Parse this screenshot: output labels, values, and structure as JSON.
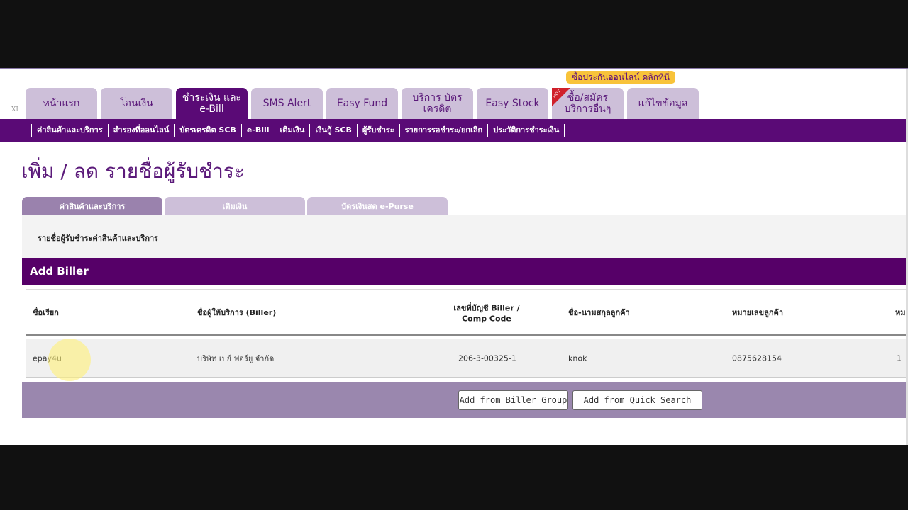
{
  "promo": "ซื้อประกันออนไลน์ คลิกที่นี่",
  "xi": "XI",
  "tabs": [
    {
      "label": "หน้าแรก"
    },
    {
      "label": "โอนเงิน"
    },
    {
      "label": "ชำระเงิน และ e-Bill",
      "active": true
    },
    {
      "label": "SMS Alert"
    },
    {
      "label": "Easy Fund"
    },
    {
      "label": "บริการ บัตรเครดิต"
    },
    {
      "label": "Easy Stock"
    },
    {
      "label": "ซื้อ/สมัคร บริการอื่นๆ",
      "badge": "HOT"
    },
    {
      "label": "แก้ไขข้อมูล"
    }
  ],
  "subnav": [
    "ค่าสินค้าและบริการ",
    "สำรองที่ออนไลน์",
    "บัตรเครดิต SCB",
    "e-Bill",
    "เติมเงิน",
    "เงินกู้ SCB",
    "ผู้รับชำระ",
    "รายการรอชำระ/ยกเลิก",
    "ประวัติการชำระเงิน"
  ],
  "page_title": "เพิ่ม / ลด รายชื่อผู้รับชำระ",
  "subtabs": [
    {
      "label": "ค่าสินค้าและบริการ",
      "active": true
    },
    {
      "label": "เติมเงิน"
    },
    {
      "label": "บัตรเงินสด e-Purse"
    }
  ],
  "panel_label": "รายชื่อผู้รับชำระค่าสินค้าและบริการ",
  "section_title": "Add Biller",
  "table": {
    "headers": [
      "ชื่อเรียก",
      "ชื่อผู้ให้บริการ (Biller)",
      "เลขที่บัญชี Biller / Comp Code",
      "ชื่อ-นามสกุลลูกค้า",
      "หมายเลขลูกค้า",
      "หม"
    ],
    "rows": [
      [
        "epay4u",
        "บริษัท เปย์ ฟอร์ยู จำกัด",
        "206-3-00325-1",
        "knok",
        "0875628154",
        "1"
      ]
    ]
  },
  "buttons": {
    "biller_group": "Add from Biller Group",
    "quick_search": "Add from Quick Search"
  },
  "colors": {
    "brand_purple": "#5a0a76",
    "tab_inactive": "#cdbfd9",
    "promo": "#f8c33a"
  }
}
